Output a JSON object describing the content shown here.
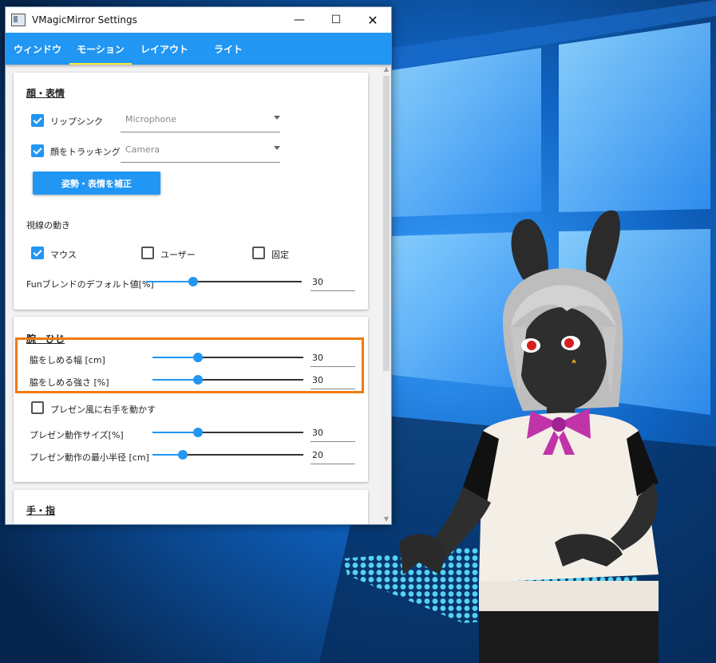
{
  "window": {
    "title": "VMagicMirror Settings",
    "minimize_glyph": "—",
    "maximize_glyph": "☐",
    "close_glyph": "✕"
  },
  "tabs": [
    {
      "label": "ウィンドウ",
      "active": false
    },
    {
      "label": "モーション",
      "active": true
    },
    {
      "label": "レイアウト",
      "active": false
    },
    {
      "label": "ライト",
      "active": false
    }
  ],
  "face_section": {
    "title": "顔・表情",
    "lipsync": {
      "label": "リップシンク",
      "checked": true,
      "device": "Microphone"
    },
    "face_tracking": {
      "label": "顔をトラッキング",
      "checked": true,
      "device": "Camera"
    },
    "calibrate_button": "姿勢・表情を補正",
    "gaze_heading": "視線の動き",
    "gaze_options": [
      {
        "label": "マウス",
        "checked": true
      },
      {
        "label": "ユーザー",
        "checked": false
      },
      {
        "label": "固定",
        "checked": false
      }
    ],
    "fun_blend": {
      "label": "Funブレンドのデフォルト値[%]",
      "value": "30",
      "fraction": 0.3
    }
  },
  "arm_section": {
    "title": "腕・ひじ",
    "waist_width": {
      "label": "脇をしめる幅 [cm]",
      "value": "30",
      "fraction": 0.3
    },
    "waist_strength": {
      "label": "脇をしめる強さ [%]",
      "value": "30",
      "fraction": 0.3
    },
    "presentation": {
      "label": "プレゼン風に右手を動かす",
      "checked": false
    },
    "presentation_size": {
      "label": "プレゼン動作サイズ[%]",
      "value": "30",
      "fraction": 0.3
    },
    "presentation_radius": {
      "label": "プレゼン動作の最小半径 [cm]",
      "value": "20",
      "fraction": 0.2
    }
  },
  "hand_section": {
    "title": "手・指"
  },
  "colors": {
    "accent": "#2196f3",
    "highlight": "#f07a10",
    "desktop": "#0a3f7a"
  }
}
